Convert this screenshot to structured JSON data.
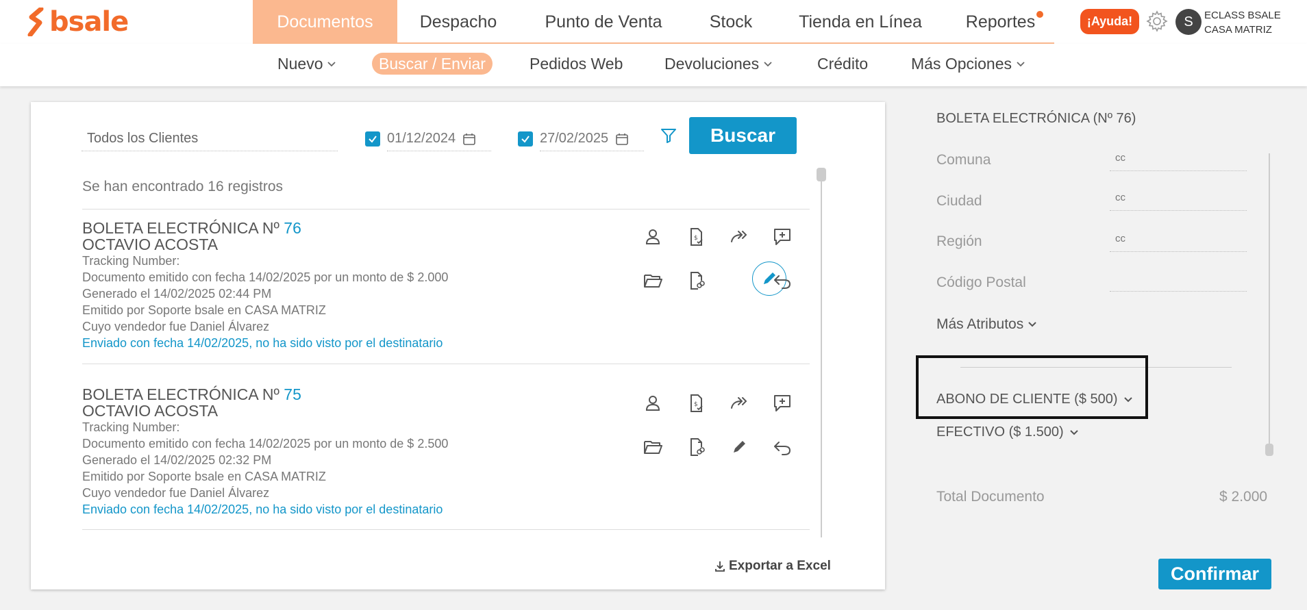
{
  "brand": {
    "name": "bsale",
    "color": "#f26b2a"
  },
  "main_nav": [
    {
      "label": "Documentos",
      "active": true
    },
    {
      "label": "Despacho"
    },
    {
      "label": "Punto de Venta"
    },
    {
      "label": "Stock"
    },
    {
      "label": "Tienda en Línea"
    },
    {
      "label": "Reportes",
      "notification": true
    }
  ],
  "header": {
    "help_label": "¡Ayuda!",
    "avatar_initial": "S",
    "company": "ECLASS BSALE",
    "branch": "CASA MATRIZ",
    "settings_icon": "gear-icon"
  },
  "sub_nav": [
    {
      "label": "Nuevo",
      "dropdown": true
    },
    {
      "label": "Buscar / Enviar",
      "active": true
    },
    {
      "label": "Pedidos Web"
    },
    {
      "label": "Devoluciones",
      "dropdown": true
    },
    {
      "label": "Crédito"
    },
    {
      "label": "Más Opciones",
      "dropdown": true
    }
  ],
  "search": {
    "client_value": "Todos los Clientes",
    "date_from": "01/12/2024",
    "date_from_checked": true,
    "date_to": "27/02/2025",
    "date_to_checked": true,
    "search_button": "Buscar"
  },
  "results": {
    "count_text": "Se han encontrado 16 registros",
    "documents": [
      {
        "title": "BOLETA ELECTRÓNICA Nº",
        "number": "76",
        "client": "OCTAVIO ACOSTA",
        "tracking": "Tracking Number:",
        "issued": "Documento emitido con fecha 14/02/2025 por un monto de $ 2.000",
        "generated": "Generado el 14/02/2025 02:44 PM",
        "emitted_by": "Emitido por Soporte bsale en CASA MATRIZ",
        "seller": "Cuyo vendedor fue Daniel Álvarez",
        "sent_status": "Enviado con fecha 14/02/2025, no ha sido visto por el destinatario",
        "edit_active": true
      },
      {
        "title": "BOLETA ELECTRÓNICA Nº",
        "number": "75",
        "client": "OCTAVIO ACOSTA",
        "tracking": "Tracking Number:",
        "issued": "Documento emitido con fecha 14/02/2025 por un monto de $ 2.500",
        "generated": "Generado el 14/02/2025 02:32 PM",
        "emitted_by": "Emitido por Soporte bsale en CASA MATRIZ",
        "seller": "Cuyo vendedor fue Daniel Álvarez",
        "sent_status": "Enviado con fecha 14/02/2025, no ha sido visto por el destinatario",
        "edit_active": false
      }
    ],
    "export_label": "Exportar a Excel"
  },
  "detail": {
    "title": "BOLETA ELECTRÓNICA (Nº 76)",
    "attributes": [
      {
        "label": "Comuna",
        "value": "cc"
      },
      {
        "label": "Ciudad",
        "value": "cc"
      },
      {
        "label": "Región",
        "value": "cc"
      },
      {
        "label": "Código Postal",
        "value": ""
      }
    ],
    "more_attributes": "Más Atributos",
    "payments": [
      {
        "label": "ABONO DE CLIENTE ($ 500)"
      },
      {
        "label": "EFECTIVO ($ 1.500)"
      }
    ],
    "total_label": "Total Documento",
    "total_value": "$ 2.000",
    "confirm_button": "Confirmar"
  },
  "colors": {
    "accent": "#1396c9",
    "nav_active": "#fbb88f",
    "help": "#f2541e"
  }
}
